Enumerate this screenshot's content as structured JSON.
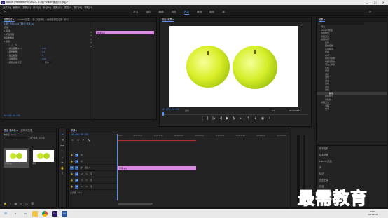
{
  "app": {
    "title": "Adobe Premiere Pro 2020 - C:\\用户\\Fiber\\桌面\\未命名 *",
    "logo_text": "Pr",
    "window_controls": [
      "—",
      "☐",
      "✕"
    ]
  },
  "menu": [
    "文件(F)",
    "编辑(E)",
    "剪辑(C)",
    "序列(S)",
    "标记(M)",
    "图形(G)",
    "视图(V)",
    "窗口(W)",
    "帮助(H)"
  ],
  "workspaces": {
    "tabs": [
      "学习",
      "组件",
      "编辑",
      "颜色",
      "效果",
      "音频",
      "图形",
      "库"
    ],
    "active": "效果"
  },
  "effect_controls": {
    "tabs": [
      "效果控件 ≡",
      "Lumetri 范围",
      "源: (无剪辑)",
      "音频剪辑混合器: 序列"
    ],
    "header": "主要 * 苹果.jpg ∨ 序列 * 苹果.jpg",
    "clip_label": "苹果.jpg",
    "section_video": "视频",
    "items": [
      {
        "label": "fx 运动",
        "value": ""
      },
      {
        "label": "fx 不透明度",
        "value": ""
      },
      {
        "label": "时间重映射",
        "value": ""
      },
      {
        "label": "fx 颜色",
        "value": ""
      }
    ],
    "params": [
      {
        "label": "○ 颜色容差(0...)",
        "value": "0.00"
      },
      {
        "label": "○ 颜色数量",
        "value": "1.0"
      },
      {
        "label": "○ 溢出数量",
        "value": "0"
      },
      {
        "label": "○ 边缘细化",
        "value": "0.00"
      },
      {
        "label": "○ 颜色边缘修正",
        "value": "整体"
      }
    ],
    "timecode": "00:00:00:00"
  },
  "program_monitor": {
    "tab": "节目: 苹果 ≡",
    "timecode_left": "00:00:00:00",
    "fit": "适合",
    "quality": "完整",
    "timecode_right": "00:00:02:23",
    "scale": "1/2"
  },
  "effects_panel": {
    "tab": "效果 ≡",
    "search_placeholder": "",
    "items": [
      "预设",
      "Lumetri 预设",
      "音频效果",
      "音频过渡",
      "视频效果",
      "变换",
      "图像控制",
      "实用程序",
      "扭曲",
      "时间",
      "杂色与颗粒",
      "模糊与锐化",
      "沉浸式视频",
      "生成",
      "视频",
      "调整",
      "过时",
      "过渡",
      "透视",
      "通道",
      "键控",
      "颜色校正",
      "风格化",
      "视频过渡",
      "溶解",
      "内滑"
    ],
    "highlight": "颜色",
    "right_items": [
      "基本图形",
      "基本声音",
      "Lumetri 颜色",
      "库",
      "标记",
      "历史记录",
      "信息"
    ]
  },
  "project_panel": {
    "tabs": [
      "项目: 未命名 ≡",
      "媒体浏览器",
      "库"
    ],
    "path": "未命名.prproj",
    "count": "1 项已选择，共 2 项",
    "bin_items": [
      {
        "name": "苹果.jpg",
        "duration": "5:00"
      },
      {
        "name": "苹果",
        "duration": "5:00"
      }
    ]
  },
  "timeline": {
    "tab": "苹果 ≡",
    "timecode": "00:00:00:00",
    "ruler": [
      "00:00",
      "00:00:05:00",
      "00:00:10:00",
      "00:00:15:00",
      "00:00:20:00",
      "00:00:25:00",
      "00:00:30:00",
      "00:00:35:00",
      "00:00:40:00"
    ],
    "tracks": [
      {
        "id": "V3",
        "label": ""
      },
      {
        "id": "V2",
        "label": ""
      },
      {
        "id": "V1",
        "label": "视频 1"
      },
      {
        "id": "A1",
        "label": ""
      },
      {
        "id": "A2",
        "label": ""
      },
      {
        "id": "A3",
        "label": ""
      },
      {
        "id": "主声道",
        "label": "0.0"
      }
    ],
    "clip_label": "苹果.jpg"
  },
  "taskbar": {
    "time": "15:06",
    "date": "2021/11/18",
    "icons": [
      "windows-icon",
      "search-icon",
      "taskview-icon",
      "explorer-icon",
      "chrome-icon",
      "premiere-icon",
      "word-icon"
    ]
  },
  "watermark": "最需教育",
  "colors": {
    "accent": "#4f8df0",
    "clip": "#d88be0",
    "watermark": "#2d4fa8"
  }
}
